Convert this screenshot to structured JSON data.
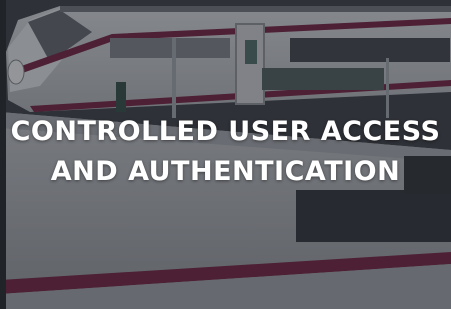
{
  "hero": {
    "title_line_1": "CONTROLLED USER ACCESS",
    "title_line_2": "AND AUTHENTICATION",
    "image_subject": "high-speed-train-at-platform",
    "overlay_color": "#1e2228",
    "train_stripe_color": "#6e1f3f"
  }
}
